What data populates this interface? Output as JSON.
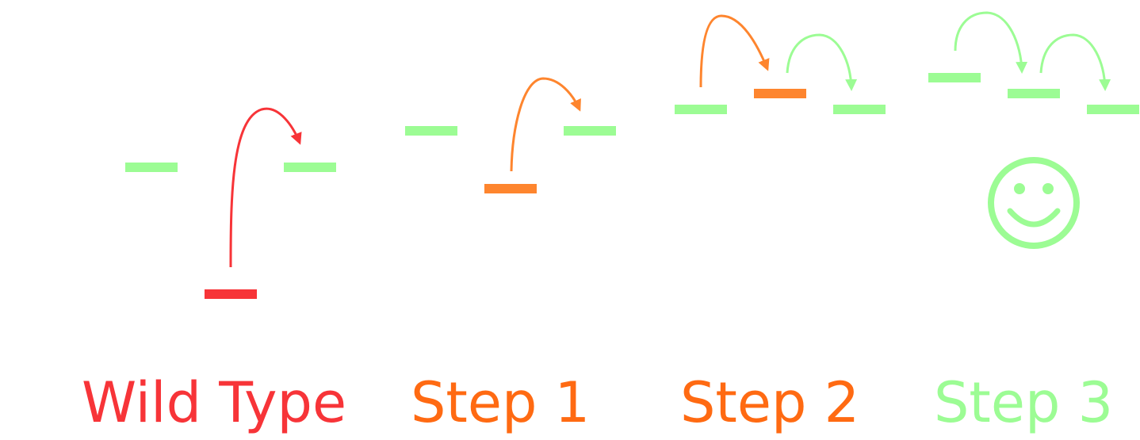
{
  "colors": {
    "red": "#f73438",
    "orange": "#fe852e",
    "orange_text": "#ff6a12",
    "green": "#9cfc94"
  },
  "stages": [
    {
      "label": "Wild Type"
    },
    {
      "label": "Step 1"
    },
    {
      "label": "Step 2"
    },
    {
      "label": "Step 3"
    }
  ],
  "smiley_icon": "smiley-face-icon"
}
